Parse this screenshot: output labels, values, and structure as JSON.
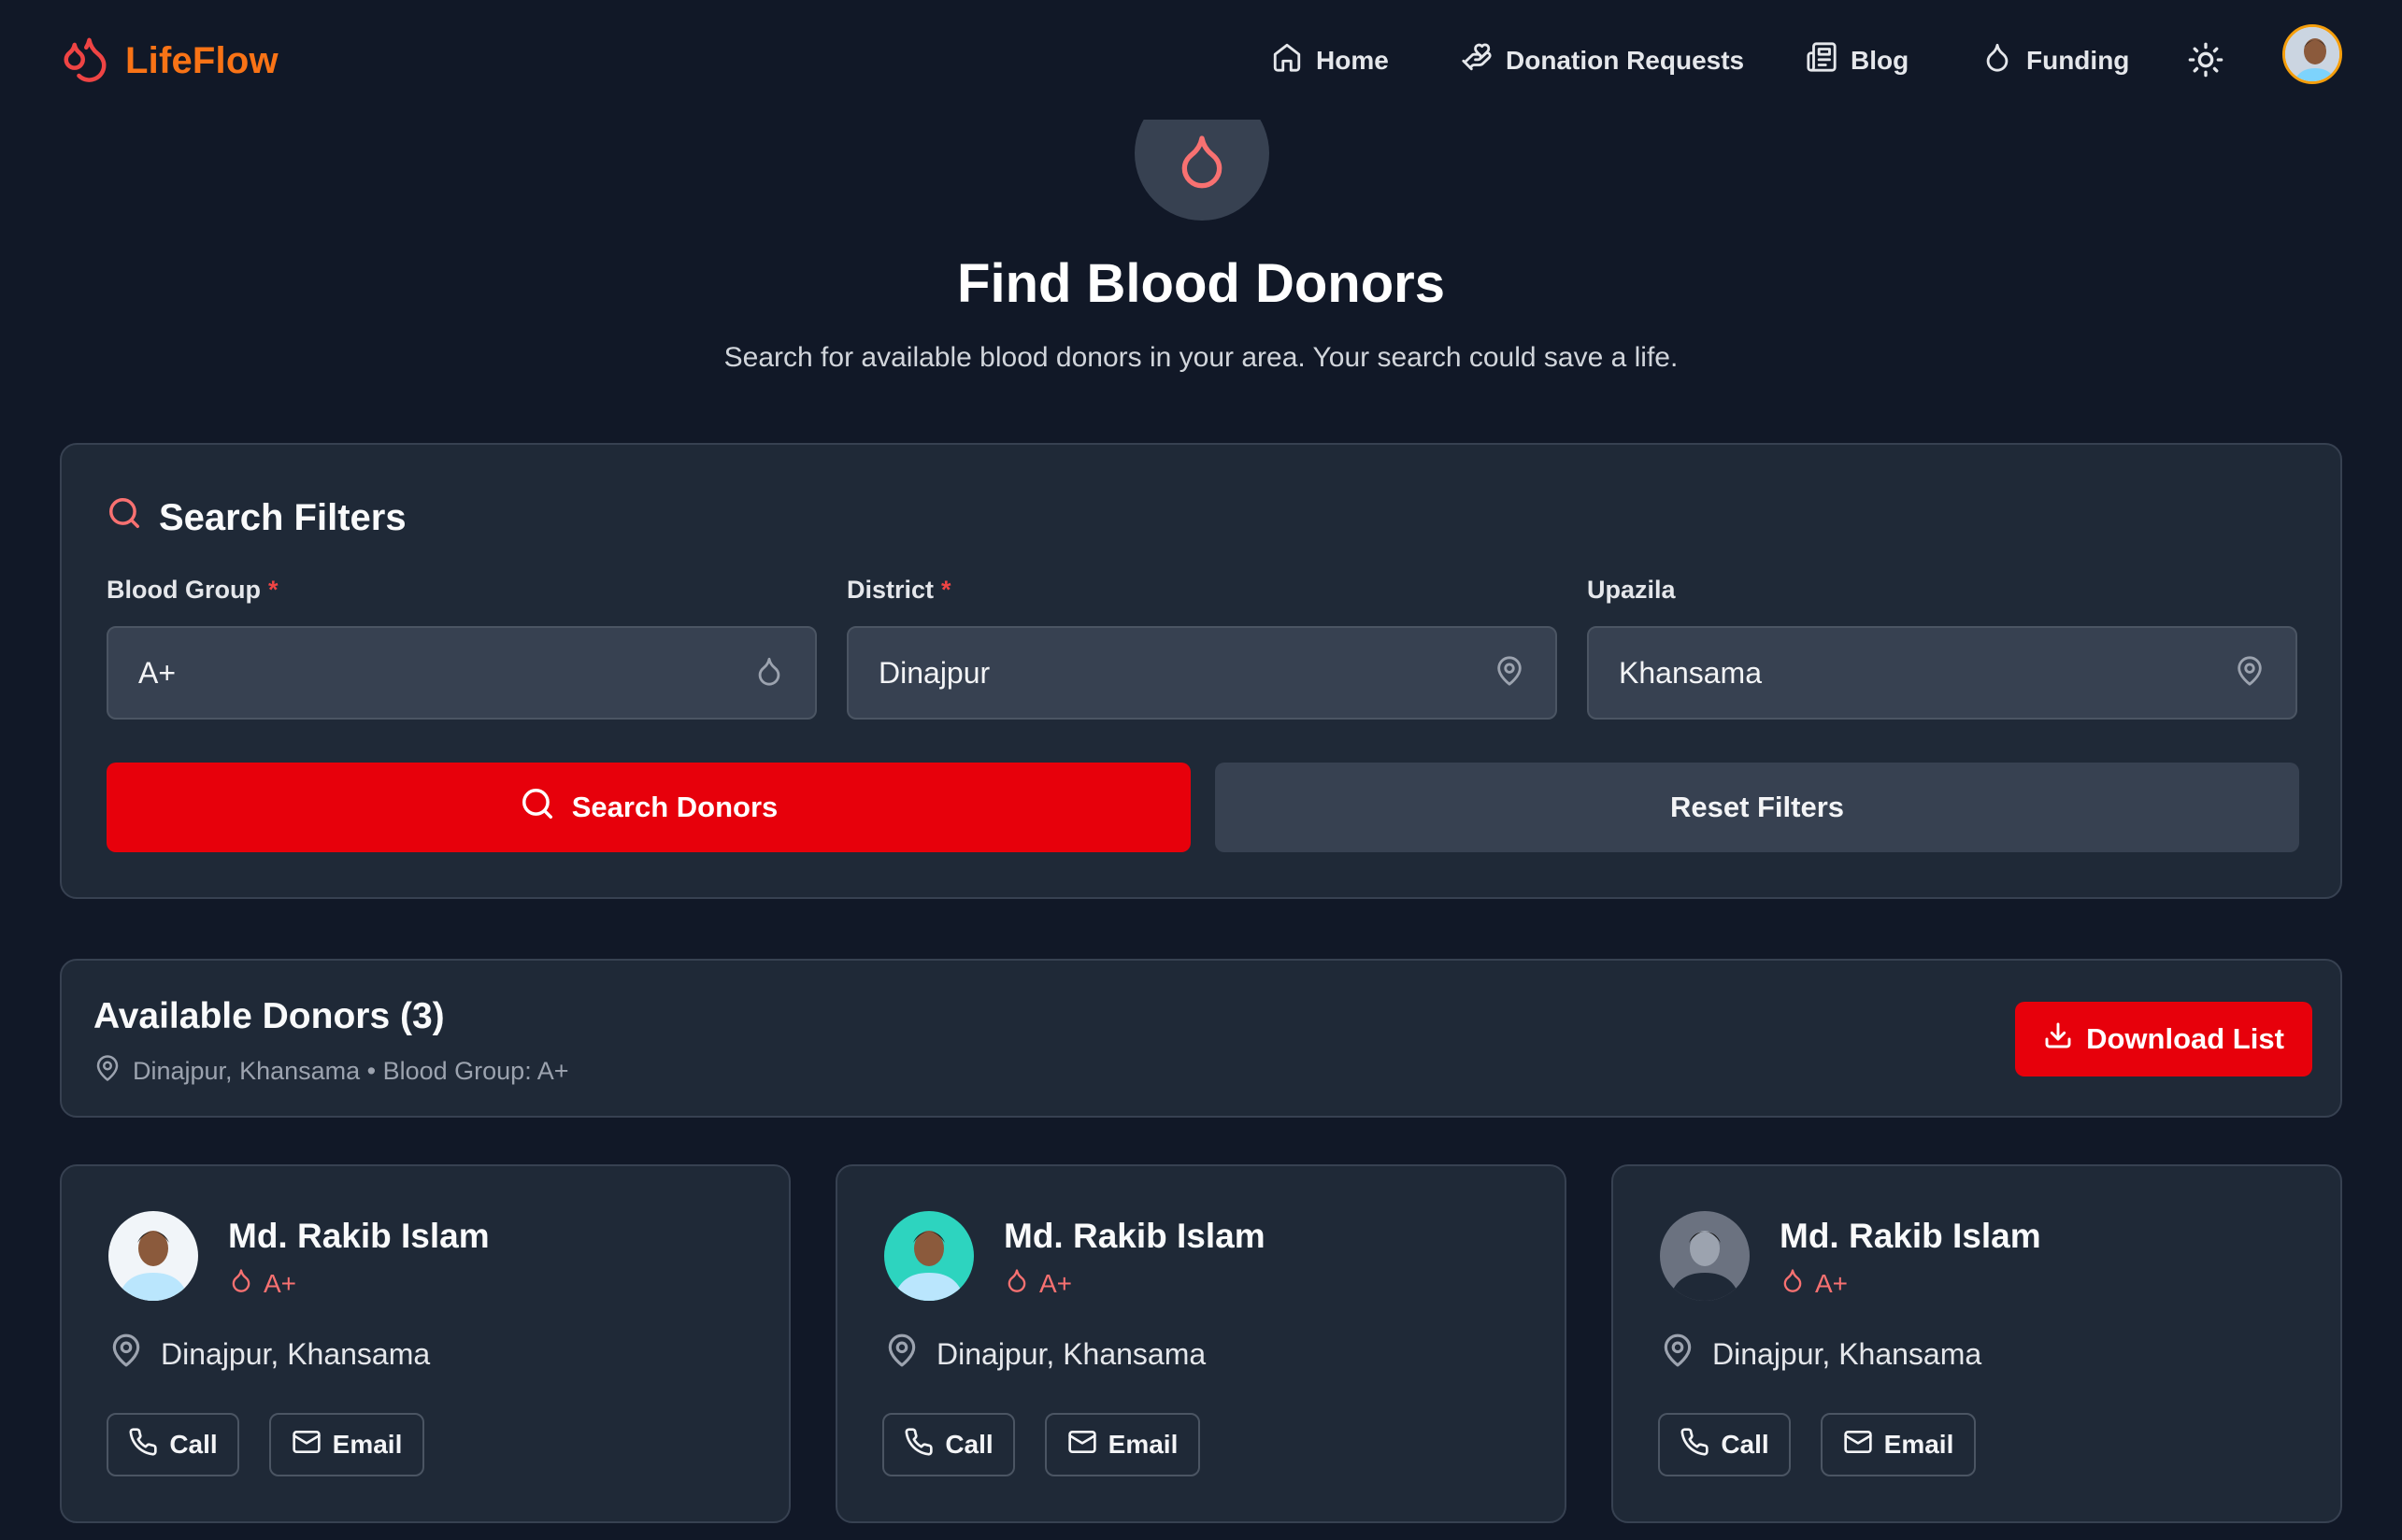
{
  "brand": {
    "name": "LifeFlow",
    "accent": "#f97316",
    "logo_color": "#ef4444"
  },
  "nav": {
    "home": "Home",
    "donation_requests": "Donation Requests",
    "blog": "Blog",
    "funding": "Funding",
    "theme_icon": "sun-icon"
  },
  "hero": {
    "title": "Find Blood Donors",
    "subtitle": "Search for available blood donors in your area. Your search could save a life."
  },
  "filters": {
    "heading": "Search Filters",
    "blood_group": {
      "label": "Blood Group",
      "required": "*",
      "value": "A+",
      "icon": "droplet-icon"
    },
    "district": {
      "label": "District",
      "required": "*",
      "value": "Dinajpur",
      "icon": "map-pin-icon"
    },
    "upazila": {
      "label": "Upazila",
      "value": "Khansama",
      "icon": "map-pin-icon"
    },
    "search_button": "Search Donors",
    "reset_button": "Reset Filters"
  },
  "results": {
    "title": "Available Donors (3)",
    "meta": "Dinajpur, Khansama • Blood Group: A+",
    "download_button": "Download List"
  },
  "donors": [
    {
      "name": "Md. Rakib Islam",
      "blood_group": "A+",
      "location": "Dinajpur, Khansama",
      "call": "Call",
      "email": "Email"
    },
    {
      "name": "Md. Rakib Islam",
      "blood_group": "A+",
      "location": "Dinajpur, Khansama",
      "call": "Call",
      "email": "Email"
    },
    {
      "name": "Md. Rakib Islam",
      "blood_group": "A+",
      "location": "Dinajpur, Khansama",
      "call": "Call",
      "email": "Email"
    }
  ],
  "colors": {
    "background": "#111827",
    "card": "#1f2937",
    "primary_red": "#e7000b",
    "accent_red": "#f87171"
  }
}
